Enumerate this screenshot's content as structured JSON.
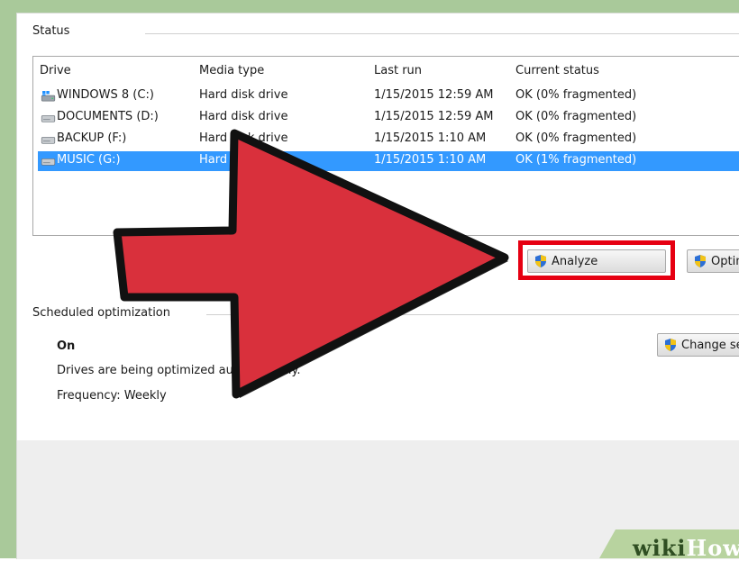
{
  "status_section": {
    "label": "Status"
  },
  "drive_list": {
    "columns": [
      "Drive",
      "Media type",
      "Last run",
      "Current status"
    ],
    "rows": [
      {
        "drive": "WINDOWS 8 (C:)",
        "media": "Hard disk drive",
        "last_run": "1/15/2015 12:59 AM",
        "status": "OK (0% fragmented)",
        "icon": "windows-drive-icon",
        "selected": false
      },
      {
        "drive": "DOCUMENTS (D:)",
        "media": "Hard disk drive",
        "last_run": "1/15/2015 12:59 AM",
        "status": "OK (0% fragmented)",
        "icon": "hard-drive-icon",
        "selected": false
      },
      {
        "drive": "BACKUP (F:)",
        "media": "Hard disk drive",
        "last_run": "1/15/2015 1:10 AM",
        "status": "OK (0% fragmented)",
        "icon": "hard-drive-icon",
        "selected": false
      },
      {
        "drive": "MUSIC (G:)",
        "media": "Hard disk drive",
        "last_run": "1/15/2015 1:10 AM",
        "status": "OK (1% fragmented)",
        "icon": "hard-drive-icon",
        "selected": true
      }
    ]
  },
  "buttons": {
    "analyze": "Analyze",
    "optimize": "Optimize",
    "change_settings": "Change settings"
  },
  "scheduled": {
    "label": "Scheduled optimization",
    "state": "On",
    "description": "Drives are being optimized automatically.",
    "frequency": "Frequency: Weekly"
  },
  "watermark": {
    "wiki": "wiki",
    "how": "How"
  },
  "colors": {
    "selection": "#3399ff",
    "arrow": "#d9303c",
    "highlight": "#e60012",
    "frame": "#a9c99a"
  }
}
